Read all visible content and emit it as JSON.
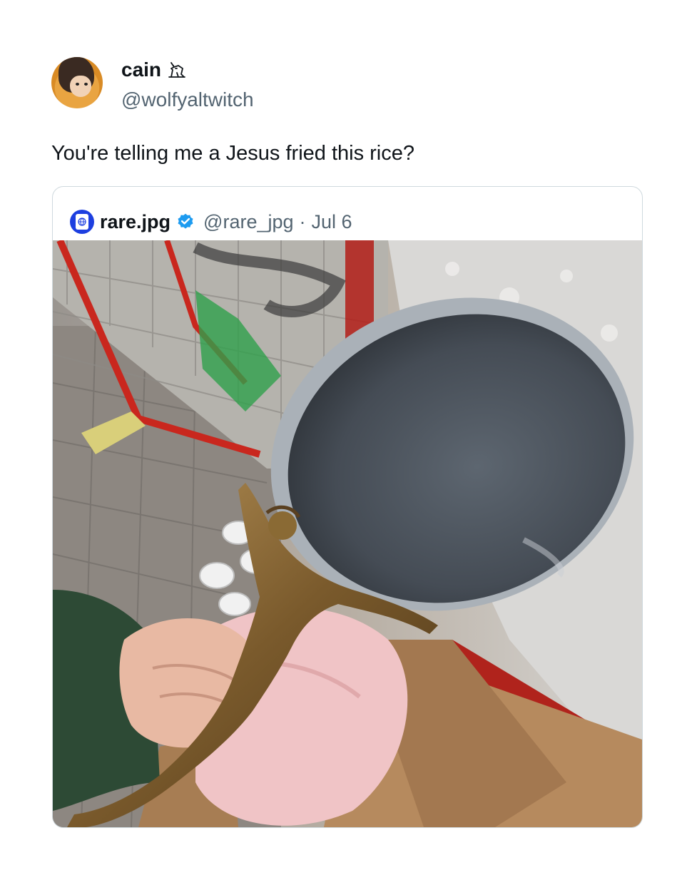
{
  "author": {
    "display_name": "cain",
    "name_emoji_icon": "cat-icon",
    "handle": "@wolfyaltwitch",
    "avatar_icon": "avatar-illustration"
  },
  "tweet": {
    "text": "You're telling me a Jesus fried this rice?"
  },
  "quoted_tweet": {
    "display_name": "rare.jpg",
    "verified_icon": "verified-badge-icon",
    "handle": "@rare_jpg",
    "separator": "·",
    "date": "Jul 6",
    "image_description_icon": "photo-crucifix-frying-pan"
  },
  "colors": {
    "text_primary": "#0f1419",
    "text_secondary": "#536471",
    "border": "#cfd9de",
    "verified_blue": "#1d9bf0",
    "quote_avatar_blue": "#1d3fe0"
  }
}
